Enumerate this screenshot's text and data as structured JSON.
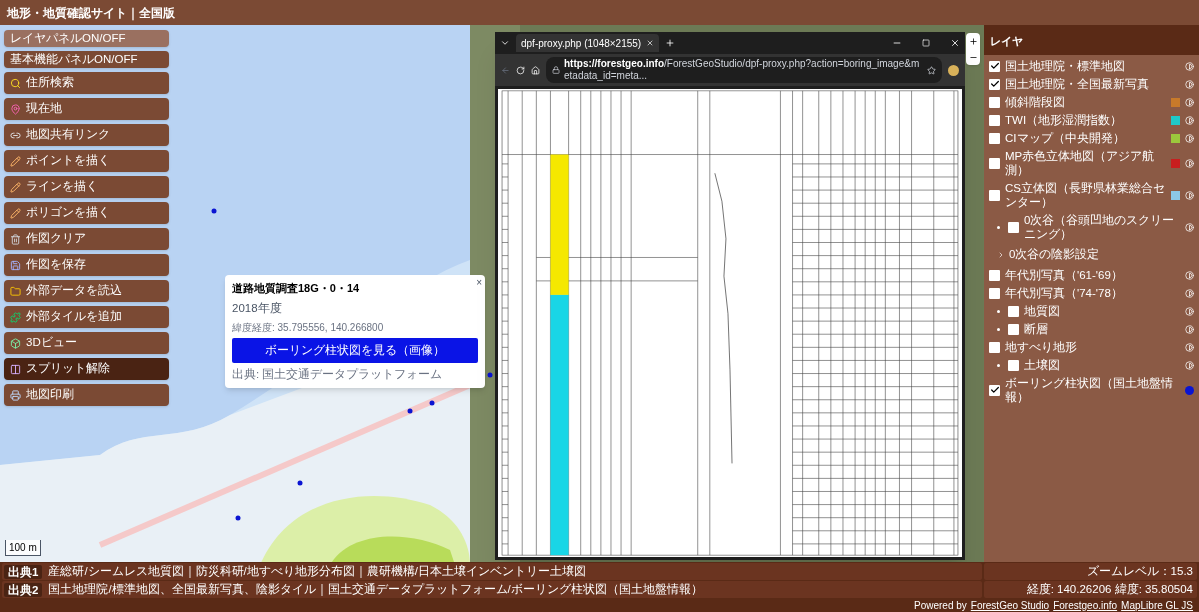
{
  "header": {
    "title": "地形・地質確認サイト｜全国版"
  },
  "tools": [
    {
      "label": "レイヤパネルON/OFF",
      "kind": "toggle",
      "selected": false
    },
    {
      "label": "基本機能パネルON/OFF",
      "kind": "toggle",
      "selected": false
    },
    {
      "label": "住所検索",
      "kind": "tool",
      "selected": false
    },
    {
      "label": "現在地",
      "kind": "tool",
      "selected": false
    },
    {
      "label": "地図共有リンク",
      "kind": "tool",
      "selected": false
    },
    {
      "label": "ポイントを描く",
      "kind": "tool",
      "selected": false
    },
    {
      "label": "ラインを描く",
      "kind": "tool",
      "selected": false
    },
    {
      "label": "ポリゴンを描く",
      "kind": "tool",
      "selected": false
    },
    {
      "label": "作図クリア",
      "kind": "tool",
      "selected": false
    },
    {
      "label": "作図を保存",
      "kind": "tool",
      "selected": false
    },
    {
      "label": "外部データを読込",
      "kind": "tool",
      "selected": false
    },
    {
      "label": "外部タイルを追加",
      "kind": "tool",
      "selected": false
    },
    {
      "label": "3Dビュー",
      "kind": "tool",
      "selected": false
    },
    {
      "label": "スプリット解除",
      "kind": "tool",
      "selected": true
    },
    {
      "label": "地図印刷",
      "kind": "tool",
      "selected": false
    }
  ],
  "popup": {
    "title": "道路地質調査18G・0・14",
    "year": "2018年度",
    "coords": "緯度経度: 35.795556, 140.266800",
    "button": "ボーリング柱状図を見る（画像）",
    "source": "出典: 国土交通データプラットフォーム",
    "close": "×"
  },
  "browser": {
    "tab": "dpf-proxy.php (1048×2155)",
    "url_host": "https://forestgeo.info",
    "url_path": "/ForestGeoStudio/dpf-proxy.php?action=boring_image&metadata_id=meta..."
  },
  "layers": {
    "title": "レイヤ",
    "items": [
      {
        "kind": "layer",
        "label": "国土地理院・標準地図",
        "checked": true
      },
      {
        "kind": "layer",
        "label": "国土地理院・全国最新写真",
        "checked": true
      },
      {
        "kind": "layer",
        "label": "傾斜階段図",
        "checked": false,
        "color": "#c87a2a"
      },
      {
        "kind": "layer",
        "label": "TWI（地形湿潤指数）",
        "checked": false,
        "color": "#1fc8c8"
      },
      {
        "kind": "layer",
        "label": "CIマップ（中央開発）",
        "checked": false,
        "color": "#9cc83c"
      },
      {
        "kind": "layer",
        "label": "MP赤色立体地図（アジア航測）",
        "checked": false,
        "color": "#c81e1e"
      },
      {
        "kind": "layer",
        "label": "CS立体図（長野県林業総合センター）",
        "checked": false,
        "color": "#8cc8e8",
        "children": [
          {
            "kind": "layer",
            "label": "0次谷（谷頭凹地のスクリーニング）",
            "checked": false
          }
        ]
      },
      {
        "kind": "setting",
        "label": "0次谷の陰影設定"
      },
      {
        "kind": "layer",
        "label": "年代別写真（'61-'69）",
        "checked": false
      },
      {
        "kind": "layer",
        "label": "年代別写真（'74-'78）",
        "checked": false,
        "children": [
          {
            "kind": "layer",
            "label": "地質図",
            "checked": false
          },
          {
            "kind": "layer",
            "label": "断層",
            "checked": false
          }
        ]
      },
      {
        "kind": "layer",
        "label": "地すべり地形",
        "checked": false,
        "children": [
          {
            "kind": "layer",
            "label": "土壌図",
            "checked": false
          }
        ]
      },
      {
        "kind": "point_layer",
        "label": "ボーリング柱状図（国土地盤情報）",
        "checked": true,
        "color": "#0a14d2"
      }
    ]
  },
  "scale": "100 m",
  "sources": [
    {
      "tag": "出典1",
      "text": "産総研/シームレス地質図｜防災科研/地すべり地形分布図｜農研機構/日本土壌インベントリー土壌図"
    },
    {
      "tag": "出典2",
      "text": "国土地理院/標準地図、全国最新写真、陰影タイル｜国土交通データプラットフォーム/ボーリング柱状図（国土地盤情報）"
    }
  ],
  "zoom": "ズームレベル：15.3",
  "position": "経度: 140.26206 緯度: 35.80504",
  "credits": {
    "prefix": "Powered by",
    "links": [
      "ForestGeo Studio",
      "Forestgeo.info",
      "MapLibre GL JS"
    ]
  }
}
